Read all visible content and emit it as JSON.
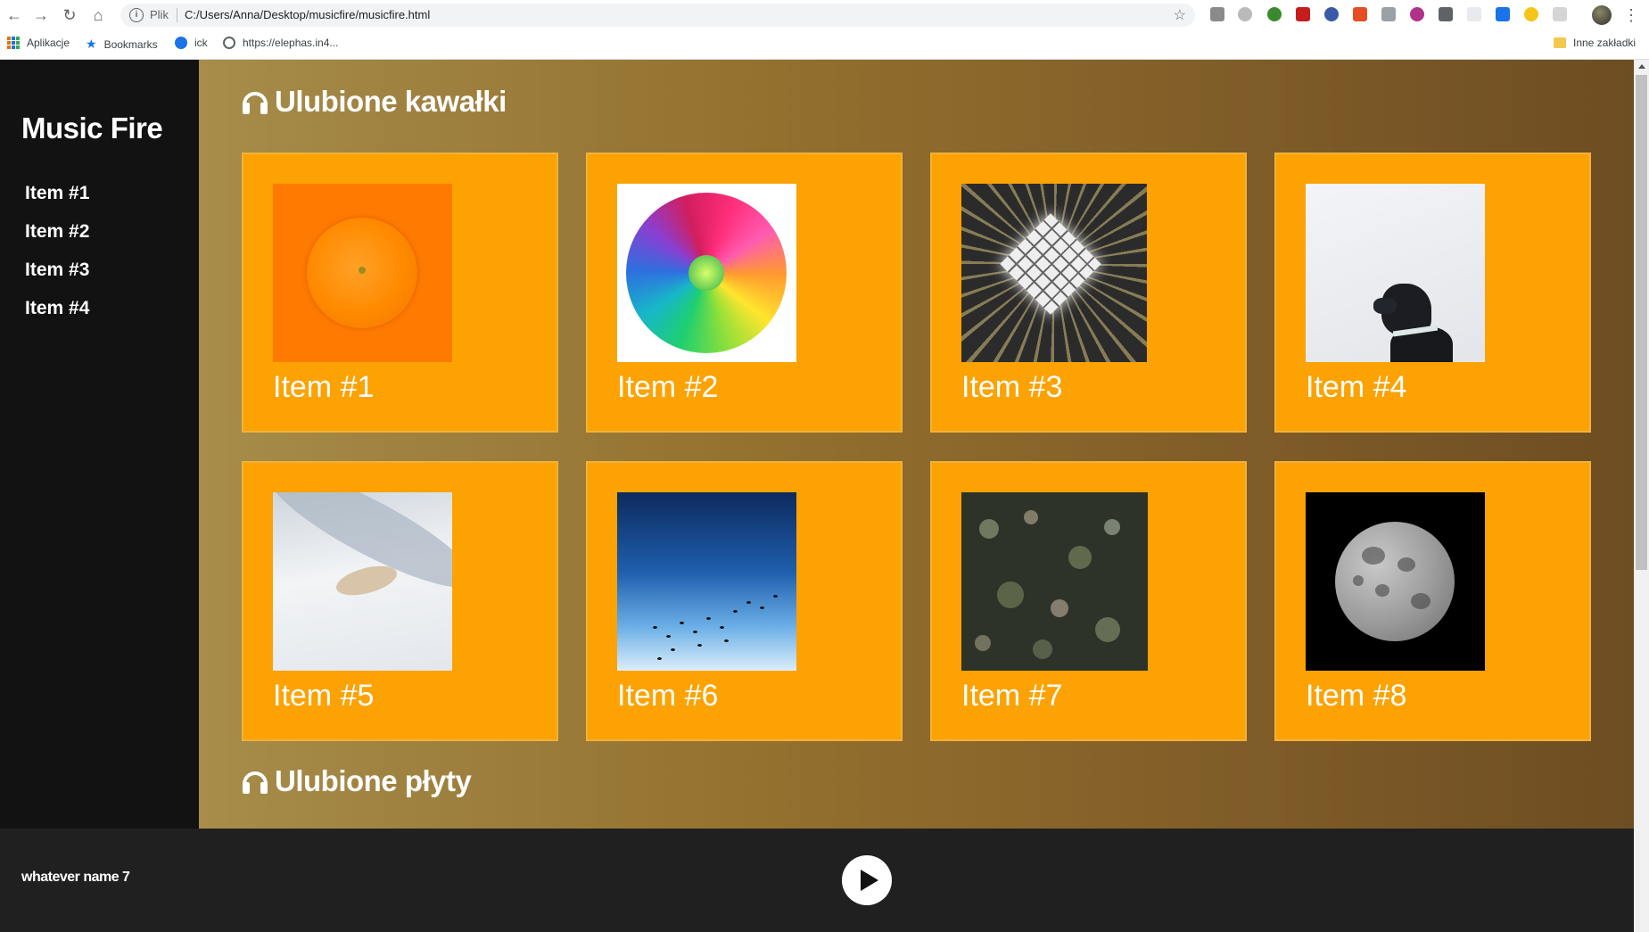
{
  "browser": {
    "scheme_label": "Plik",
    "url": "C:/Users/Anna/Desktop/musicfire/musicfire.html",
    "bookmarks": [
      {
        "label": "Aplikacje",
        "icon": "apps-icon"
      },
      {
        "label": "Bookmarks",
        "icon": "star-icon"
      },
      {
        "label": "ick",
        "icon": "circle-icon"
      },
      {
        "label": "https://elephas.in4...",
        "icon": "globe-icon"
      }
    ],
    "other_bookmarks": "Inne zakładki"
  },
  "sidebar": {
    "brand": "Music Fire",
    "items": [
      {
        "label": "Item #1"
      },
      {
        "label": "Item #2"
      },
      {
        "label": "Item #3"
      },
      {
        "label": "Item #4"
      }
    ]
  },
  "main": {
    "sections": [
      {
        "title": "Ulubione kawałki",
        "icon": "headphones-icon"
      },
      {
        "title": "Ulubione płyty",
        "icon": "headphones-icon"
      }
    ],
    "cards": [
      {
        "title": "Item #1",
        "image": "orange"
      },
      {
        "title": "Item #2",
        "image": "flower"
      },
      {
        "title": "Item #3",
        "image": "light-grid"
      },
      {
        "title": "Item #4",
        "image": "dog"
      },
      {
        "title": "Item #5",
        "image": "snow-fox"
      },
      {
        "title": "Item #6",
        "image": "birds-sky"
      },
      {
        "title": "Item #7",
        "image": "bokeh"
      },
      {
        "title": "Item #8",
        "image": "moon"
      }
    ]
  },
  "player": {
    "track_name": "whatever name 7",
    "play_icon": "play-icon"
  },
  "colors": {
    "sidebar_bg": "#121212",
    "card_bg": "#fca203",
    "player_bg": "#202020",
    "text": "#ffffff"
  }
}
